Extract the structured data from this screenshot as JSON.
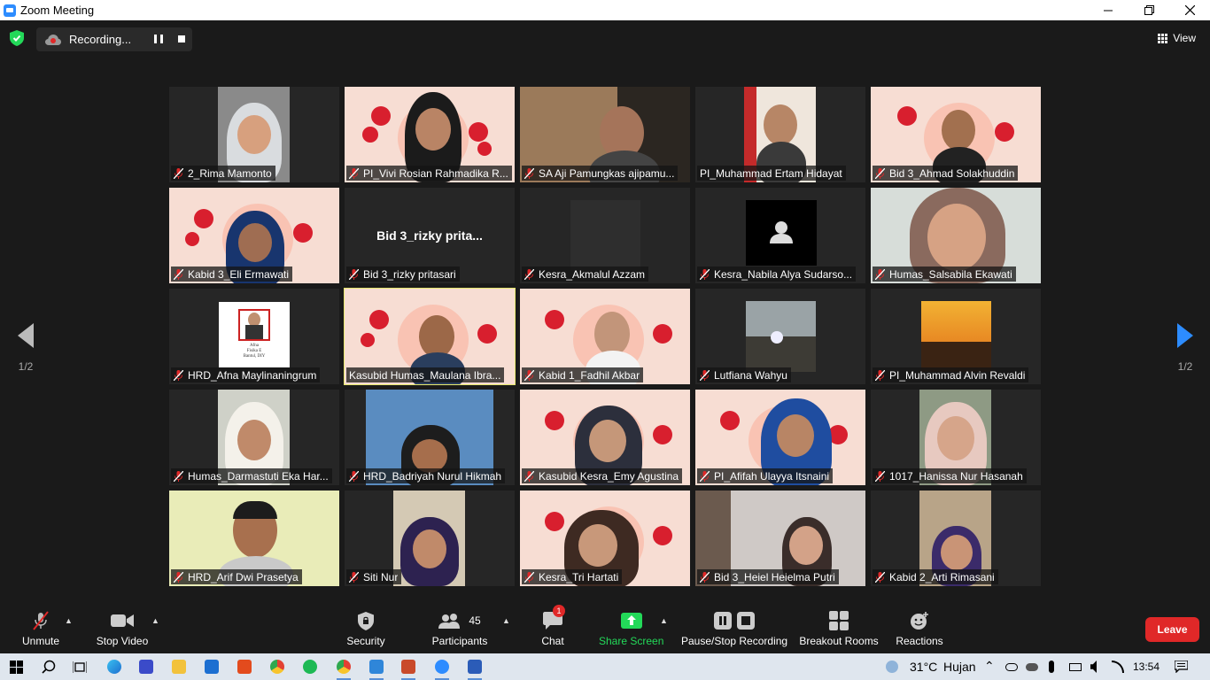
{
  "window": {
    "title": "Zoom Meeting"
  },
  "topbar": {
    "recording_label": "Recording...",
    "view_label": "View"
  },
  "pager": {
    "left_label": "1/2",
    "right_label": "1/2"
  },
  "tiles": [
    {
      "name": "2_Rima Mamonto"
    },
    {
      "name": "PI_Vivi Rosian Rahmadika R..."
    },
    {
      "name": "SA Aji Pamungkas ajipamu..."
    },
    {
      "name": "PI_Muhammad Ertam Hidayat"
    },
    {
      "name": "Bid 3_Ahmad Solakhuddin"
    },
    {
      "name": "Kabid 3_Eli Ermawati"
    },
    {
      "name": "Bid 3_rizky pritasari",
      "display_name": "Bid 3_rizky  prita..."
    },
    {
      "name": "Kesra_Akmalul Azzam"
    },
    {
      "name": "Kesra_Nabila Alya Sudarso..."
    },
    {
      "name": "Humas_Salsabila Ekawati"
    },
    {
      "name": "HRD_Afna Maylinaningrum"
    },
    {
      "name": "Kasubid Humas_Maulana Ibra..."
    },
    {
      "name": "Kabid 1_Fadhil Akbar"
    },
    {
      "name": "Lutfiana Wahyu"
    },
    {
      "name": "PI_Muhammad Alvin Revaldi"
    },
    {
      "name": "Humas_Darmastuti Eka Har..."
    },
    {
      "name": "HRD_Badriyah Nurul Hikmah"
    },
    {
      "name": "Kasubid Kesra_Emy Agustina"
    },
    {
      "name": "PI_Afifah Ulayya Itsnaini"
    },
    {
      "name": "1017_Hanissa Nur Hasanah"
    },
    {
      "name": "HRD_Arif Dwi Prasetya"
    },
    {
      "name": "Siti Nur"
    },
    {
      "name": "Kesra_Tri Hartati"
    },
    {
      "name": "Bid 3_Heiel Heielma Putri"
    },
    {
      "name": "Kabid 2_Arti Rimasani"
    }
  ],
  "afna_card": {
    "line1": "Afna",
    "line2": "Fisika E",
    "line3": "Bantul, DIY"
  },
  "toolbar": {
    "unmute": "Unmute",
    "stop_video": "Stop Video",
    "security": "Security",
    "participants": "Participants",
    "participants_count": "45",
    "chat": "Chat",
    "chat_badge": "1",
    "share_screen": "Share Screen",
    "pause_stop_recording": "Pause/Stop Recording",
    "breakout_rooms": "Breakout Rooms",
    "reactions": "Reactions",
    "leave": "Leave"
  },
  "taskbar": {
    "temperature": "31°C",
    "weather": "Hujan",
    "time": "13:54"
  },
  "colors": {
    "share_green": "#23d959",
    "leave_red": "#e02828",
    "active_border": "#e6e86e",
    "zoom_blue": "#2d8cff"
  }
}
